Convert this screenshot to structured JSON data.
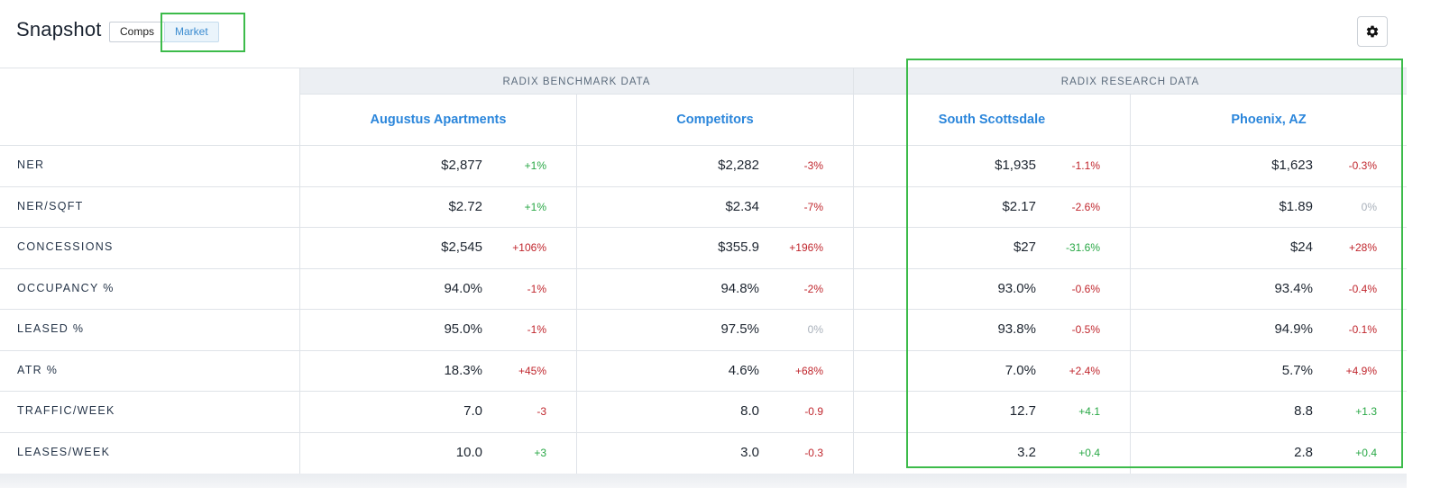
{
  "header": {
    "title": "Snapshot",
    "toggle": {
      "comps_label": "Comps",
      "market_label": "Market",
      "selected": "Market"
    }
  },
  "groups": {
    "benchmark": "RADIX BENCHMARK DATA",
    "research": "RADIX RESEARCH DATA"
  },
  "columns": [
    "Augustus Apartments",
    "Competitors",
    "South Scottsdale",
    "Phoenix, AZ"
  ],
  "rows": [
    {
      "label": "NER",
      "cells": [
        {
          "value": "$2,877",
          "change": "+1%",
          "tone": "pos"
        },
        {
          "value": "$2,282",
          "change": "-3%",
          "tone": "neg"
        },
        {
          "value": "$1,935",
          "change": "-1.1%",
          "tone": "neg"
        },
        {
          "value": "$1,623",
          "change": "-0.3%",
          "tone": "neg"
        }
      ]
    },
    {
      "label": "NER/SQFT",
      "cells": [
        {
          "value": "$2.72",
          "change": "+1%",
          "tone": "pos"
        },
        {
          "value": "$2.34",
          "change": "-7%",
          "tone": "neg"
        },
        {
          "value": "$2.17",
          "change": "-2.6%",
          "tone": "neg"
        },
        {
          "value": "$1.89",
          "change": "0%",
          "tone": "neu"
        }
      ]
    },
    {
      "label": "CONCESSIONS",
      "cells": [
        {
          "value": "$2,545",
          "change": "+106%",
          "tone": "neg"
        },
        {
          "value": "$355.9",
          "change": "+196%",
          "tone": "neg"
        },
        {
          "value": "$27",
          "change": "-31.6%",
          "tone": "pos"
        },
        {
          "value": "$24",
          "change": "+28%",
          "tone": "neg"
        }
      ]
    },
    {
      "label": "OCCUPANCY %",
      "cells": [
        {
          "value": "94.0%",
          "change": "-1%",
          "tone": "neg"
        },
        {
          "value": "94.8%",
          "change": "-2%",
          "tone": "neg"
        },
        {
          "value": "93.0%",
          "change": "-0.6%",
          "tone": "neg"
        },
        {
          "value": "93.4%",
          "change": "-0.4%",
          "tone": "neg"
        }
      ]
    },
    {
      "label": "LEASED %",
      "cells": [
        {
          "value": "95.0%",
          "change": "-1%",
          "tone": "neg"
        },
        {
          "value": "97.5%",
          "change": "0%",
          "tone": "neu"
        },
        {
          "value": "93.8%",
          "change": "-0.5%",
          "tone": "neg"
        },
        {
          "value": "94.9%",
          "change": "-0.1%",
          "tone": "neg"
        }
      ]
    },
    {
      "label": "ATR %",
      "cells": [
        {
          "value": "18.3%",
          "change": "+45%",
          "tone": "neg"
        },
        {
          "value": "4.6%",
          "change": "+68%",
          "tone": "neg"
        },
        {
          "value": "7.0%",
          "change": "+2.4%",
          "tone": "neg"
        },
        {
          "value": "5.7%",
          "change": "+4.9%",
          "tone": "neg"
        }
      ]
    },
    {
      "label": "TRAFFIC/WEEK",
      "cells": [
        {
          "value": "7.0",
          "change": "-3",
          "tone": "neg"
        },
        {
          "value": "8.0",
          "change": "-0.9",
          "tone": "neg"
        },
        {
          "value": "12.7",
          "change": "+4.1",
          "tone": "pos"
        },
        {
          "value": "8.8",
          "change": "+1.3",
          "tone": "pos"
        }
      ]
    },
    {
      "label": "LEASES/WEEK",
      "cells": [
        {
          "value": "10.0",
          "change": "+3",
          "tone": "pos"
        },
        {
          "value": "3.0",
          "change": "-0.3",
          "tone": "neg"
        },
        {
          "value": "3.2",
          "change": "+0.4",
          "tone": "pos"
        },
        {
          "value": "2.8",
          "change": "+0.4",
          "tone": "pos"
        }
      ]
    }
  ],
  "icons": {
    "settings": "gear-icon"
  },
  "colors": {
    "positive": "#29a846",
    "negative": "#c0262d",
    "neutral": "#a8b0ba",
    "link": "#2b86db",
    "highlight": "#3cbb4a"
  }
}
